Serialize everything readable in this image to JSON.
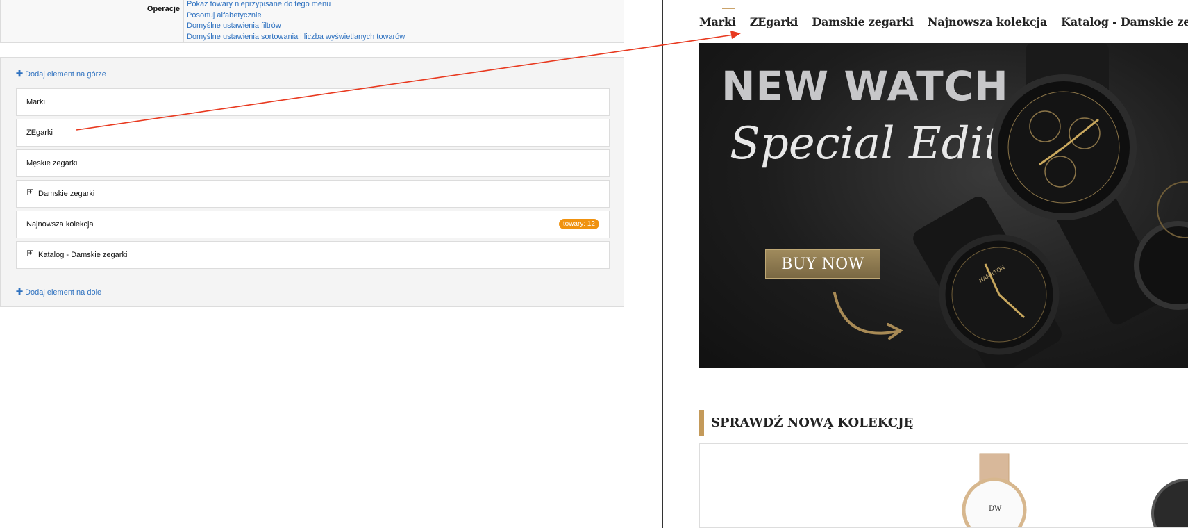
{
  "admin": {
    "operations": {
      "label": "Operacje",
      "links": [
        "Pokaż towary nieprzypisane do tego menu",
        "Posortuj alfabetycznie",
        "Domyślne ustawienia filtrów",
        "Domyślne ustawienia sortowania i liczba wyświetlanych towarów"
      ]
    },
    "add_top": "Dodaj element na górze",
    "add_bottom": "Dodaj element na dole",
    "items": [
      {
        "label": "Marki",
        "expandable": false
      },
      {
        "label": "ZEgarki",
        "expandable": false
      },
      {
        "label": "Męskie zegarki",
        "expandable": false
      },
      {
        "label": "Damskie zegarki",
        "expandable": true
      },
      {
        "label": "Najnowsza kolekcja",
        "expandable": false,
        "badge": "towary: 12"
      },
      {
        "label": "Katalog - Damskie zegarki",
        "expandable": true
      }
    ],
    "badge_color": "#f0920f",
    "link_color": "#2f72c0"
  },
  "store": {
    "nav": [
      "Marki",
      "ZEgarki",
      "Damskie zegarki",
      "Najnowsza kolekcja",
      "Katalog - Damskie zegarki"
    ],
    "banner": {
      "headline": "NEW WATCH",
      "script_text": "Special Edition",
      "cta": "BUY NOW"
    },
    "section_title": "SPRAWDŹ NOWĄ KOLEKCJĘ",
    "accent_color": "#c49a5a"
  },
  "annotation": {
    "color": "#e8391f"
  },
  "icons": {
    "plus": "plus-icon",
    "expand": "expand-icon",
    "arrow": "annotation-arrow"
  }
}
